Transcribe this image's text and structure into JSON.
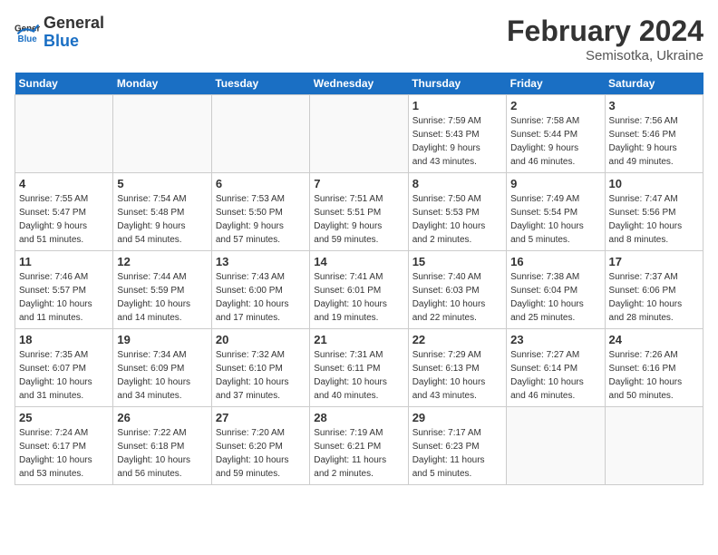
{
  "header": {
    "logo_general": "General",
    "logo_blue": "Blue",
    "month_title": "February 2024",
    "location": "Semisotka, Ukraine"
  },
  "weekdays": [
    "Sunday",
    "Monday",
    "Tuesday",
    "Wednesday",
    "Thursday",
    "Friday",
    "Saturday"
  ],
  "weeks": [
    [
      {
        "day": "",
        "info": ""
      },
      {
        "day": "",
        "info": ""
      },
      {
        "day": "",
        "info": ""
      },
      {
        "day": "",
        "info": ""
      },
      {
        "day": "1",
        "info": "Sunrise: 7:59 AM\nSunset: 5:43 PM\nDaylight: 9 hours\nand 43 minutes."
      },
      {
        "day": "2",
        "info": "Sunrise: 7:58 AM\nSunset: 5:44 PM\nDaylight: 9 hours\nand 46 minutes."
      },
      {
        "day": "3",
        "info": "Sunrise: 7:56 AM\nSunset: 5:46 PM\nDaylight: 9 hours\nand 49 minutes."
      }
    ],
    [
      {
        "day": "4",
        "info": "Sunrise: 7:55 AM\nSunset: 5:47 PM\nDaylight: 9 hours\nand 51 minutes."
      },
      {
        "day": "5",
        "info": "Sunrise: 7:54 AM\nSunset: 5:48 PM\nDaylight: 9 hours\nand 54 minutes."
      },
      {
        "day": "6",
        "info": "Sunrise: 7:53 AM\nSunset: 5:50 PM\nDaylight: 9 hours\nand 57 minutes."
      },
      {
        "day": "7",
        "info": "Sunrise: 7:51 AM\nSunset: 5:51 PM\nDaylight: 9 hours\nand 59 minutes."
      },
      {
        "day": "8",
        "info": "Sunrise: 7:50 AM\nSunset: 5:53 PM\nDaylight: 10 hours\nand 2 minutes."
      },
      {
        "day": "9",
        "info": "Sunrise: 7:49 AM\nSunset: 5:54 PM\nDaylight: 10 hours\nand 5 minutes."
      },
      {
        "day": "10",
        "info": "Sunrise: 7:47 AM\nSunset: 5:56 PM\nDaylight: 10 hours\nand 8 minutes."
      }
    ],
    [
      {
        "day": "11",
        "info": "Sunrise: 7:46 AM\nSunset: 5:57 PM\nDaylight: 10 hours\nand 11 minutes."
      },
      {
        "day": "12",
        "info": "Sunrise: 7:44 AM\nSunset: 5:59 PM\nDaylight: 10 hours\nand 14 minutes."
      },
      {
        "day": "13",
        "info": "Sunrise: 7:43 AM\nSunset: 6:00 PM\nDaylight: 10 hours\nand 17 minutes."
      },
      {
        "day": "14",
        "info": "Sunrise: 7:41 AM\nSunset: 6:01 PM\nDaylight: 10 hours\nand 19 minutes."
      },
      {
        "day": "15",
        "info": "Sunrise: 7:40 AM\nSunset: 6:03 PM\nDaylight: 10 hours\nand 22 minutes."
      },
      {
        "day": "16",
        "info": "Sunrise: 7:38 AM\nSunset: 6:04 PM\nDaylight: 10 hours\nand 25 minutes."
      },
      {
        "day": "17",
        "info": "Sunrise: 7:37 AM\nSunset: 6:06 PM\nDaylight: 10 hours\nand 28 minutes."
      }
    ],
    [
      {
        "day": "18",
        "info": "Sunrise: 7:35 AM\nSunset: 6:07 PM\nDaylight: 10 hours\nand 31 minutes."
      },
      {
        "day": "19",
        "info": "Sunrise: 7:34 AM\nSunset: 6:09 PM\nDaylight: 10 hours\nand 34 minutes."
      },
      {
        "day": "20",
        "info": "Sunrise: 7:32 AM\nSunset: 6:10 PM\nDaylight: 10 hours\nand 37 minutes."
      },
      {
        "day": "21",
        "info": "Sunrise: 7:31 AM\nSunset: 6:11 PM\nDaylight: 10 hours\nand 40 minutes."
      },
      {
        "day": "22",
        "info": "Sunrise: 7:29 AM\nSunset: 6:13 PM\nDaylight: 10 hours\nand 43 minutes."
      },
      {
        "day": "23",
        "info": "Sunrise: 7:27 AM\nSunset: 6:14 PM\nDaylight: 10 hours\nand 46 minutes."
      },
      {
        "day": "24",
        "info": "Sunrise: 7:26 AM\nSunset: 6:16 PM\nDaylight: 10 hours\nand 50 minutes."
      }
    ],
    [
      {
        "day": "25",
        "info": "Sunrise: 7:24 AM\nSunset: 6:17 PM\nDaylight: 10 hours\nand 53 minutes."
      },
      {
        "day": "26",
        "info": "Sunrise: 7:22 AM\nSunset: 6:18 PM\nDaylight: 10 hours\nand 56 minutes."
      },
      {
        "day": "27",
        "info": "Sunrise: 7:20 AM\nSunset: 6:20 PM\nDaylight: 10 hours\nand 59 minutes."
      },
      {
        "day": "28",
        "info": "Sunrise: 7:19 AM\nSunset: 6:21 PM\nDaylight: 11 hours\nand 2 minutes."
      },
      {
        "day": "29",
        "info": "Sunrise: 7:17 AM\nSunset: 6:23 PM\nDaylight: 11 hours\nand 5 minutes."
      },
      {
        "day": "",
        "info": ""
      },
      {
        "day": "",
        "info": ""
      }
    ]
  ]
}
